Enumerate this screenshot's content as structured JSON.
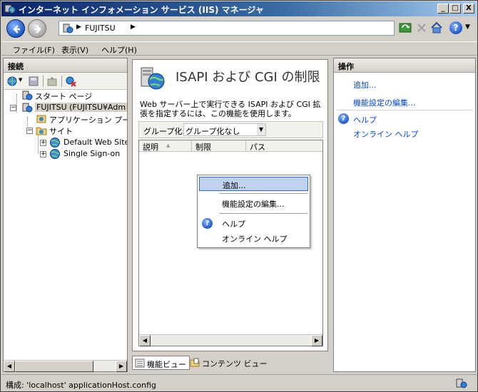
{
  "window": {
    "title": "インターネット インフォメーション サービス (IIS) マネージャ",
    "controls": [
      "_",
      "□",
      "X"
    ]
  },
  "address": {
    "crumb": "FUJITSU",
    "help_glyph": "?"
  },
  "menu": {
    "items": [
      "ファイル(F)",
      "表示(V)",
      "ヘルプ(H)"
    ]
  },
  "connections": {
    "header": "接続",
    "tree": [
      {
        "label": "スタート ページ",
        "level": 1,
        "expander": ""
      },
      {
        "label": "FUJITSU (FUJITSU¥Adm",
        "level": 0,
        "expander": "−"
      },
      {
        "label": "アプリケーション プール",
        "level": 1,
        "expander": ""
      },
      {
        "label": "サイト",
        "level": 1,
        "expander": "−"
      },
      {
        "label": "Default Web Site",
        "level": 2,
        "expander": "+"
      },
      {
        "label": "Single Sign-on",
        "level": 2,
        "expander": "+"
      }
    ]
  },
  "feature": {
    "title": "ISAPI および CGI の制限",
    "description": "Web サーバー上で実行できる ISAPI および CGI 拡張を指定するには、この機能を使用します。",
    "group_label": "グループ化:",
    "group_value": "グループ化なし",
    "columns": [
      "説明",
      "制限",
      "パス"
    ]
  },
  "context_menu": {
    "items": [
      "追加...",
      "機能設定の編集...",
      "ヘルプ",
      "オンライン ヘルプ"
    ]
  },
  "view_tabs": {
    "features": "機能ビュー",
    "content": "コンテンツ ビュー"
  },
  "actions": {
    "header": "操作",
    "add": "追加...",
    "edit_settings": "機能設定の編集...",
    "help": "ヘルプ",
    "online_help": "オンライン ヘルプ"
  },
  "status": {
    "text": "構成: 'localhost' applicationHost.config"
  },
  "colors": {
    "title_bar": "#0a246a",
    "link": "#0046d5",
    "menu_highlight": "#c1d2ee"
  }
}
